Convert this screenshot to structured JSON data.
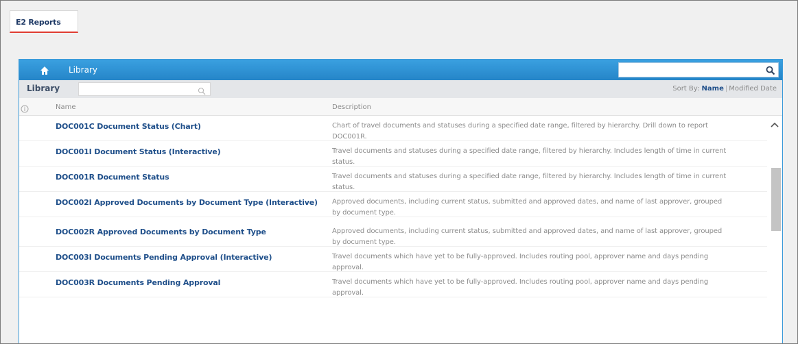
{
  "app": {
    "tab_label": "E2 Reports"
  },
  "topbar": {
    "home_icon": "home-icon",
    "breadcrumb": "Library",
    "search_value": "",
    "search_icon": "search-icon"
  },
  "library": {
    "title": "Library",
    "filter_value": "",
    "filter_icon": "search-icon",
    "sort_label": "Sort By:",
    "sort_options": [
      "Name",
      "Modified Date"
    ],
    "sort_selected": "Name"
  },
  "columns": {
    "info_icon": "info-icon",
    "name": "Name",
    "description": "Description"
  },
  "reports": [
    {
      "name": "DOC001C Document Status (Chart)",
      "description": "Chart of travel documents and statuses during a specified date range, filtered by hierarchy. Drill down to report DOC001R."
    },
    {
      "name": "DOC001I Document Status (Interactive)",
      "description": "Travel documents and statuses during a specified date range, filtered by hierarchy. Includes length of time in current status."
    },
    {
      "name": "DOC001R Document Status",
      "description": "Travel documents and statuses during a specified date range, filtered by hierarchy. Includes length of time in current status."
    },
    {
      "name": "DOC002I Approved Documents by Document Type (Interactive)",
      "description": "Approved documents, including current status, submitted and approved dates, and name of last approver, grouped by document type."
    },
    {
      "name": "DOC002R Approved Documents by Document Type",
      "description": "Approved documents, including current status, submitted and approved dates, and name of last approver, grouped by document type."
    },
    {
      "name": "DOC003I Documents Pending Approval (Interactive)",
      "description": "Travel documents which have yet to be fully-approved. Includes routing pool, approver name and days pending approval."
    },
    {
      "name": "DOC003R Documents Pending Approval",
      "description": "Travel documents which have yet to be fully-approved. Includes routing pool, approver name and days pending approval."
    }
  ],
  "scrollbar": {
    "up_icon": "chevron-up-icon"
  }
}
